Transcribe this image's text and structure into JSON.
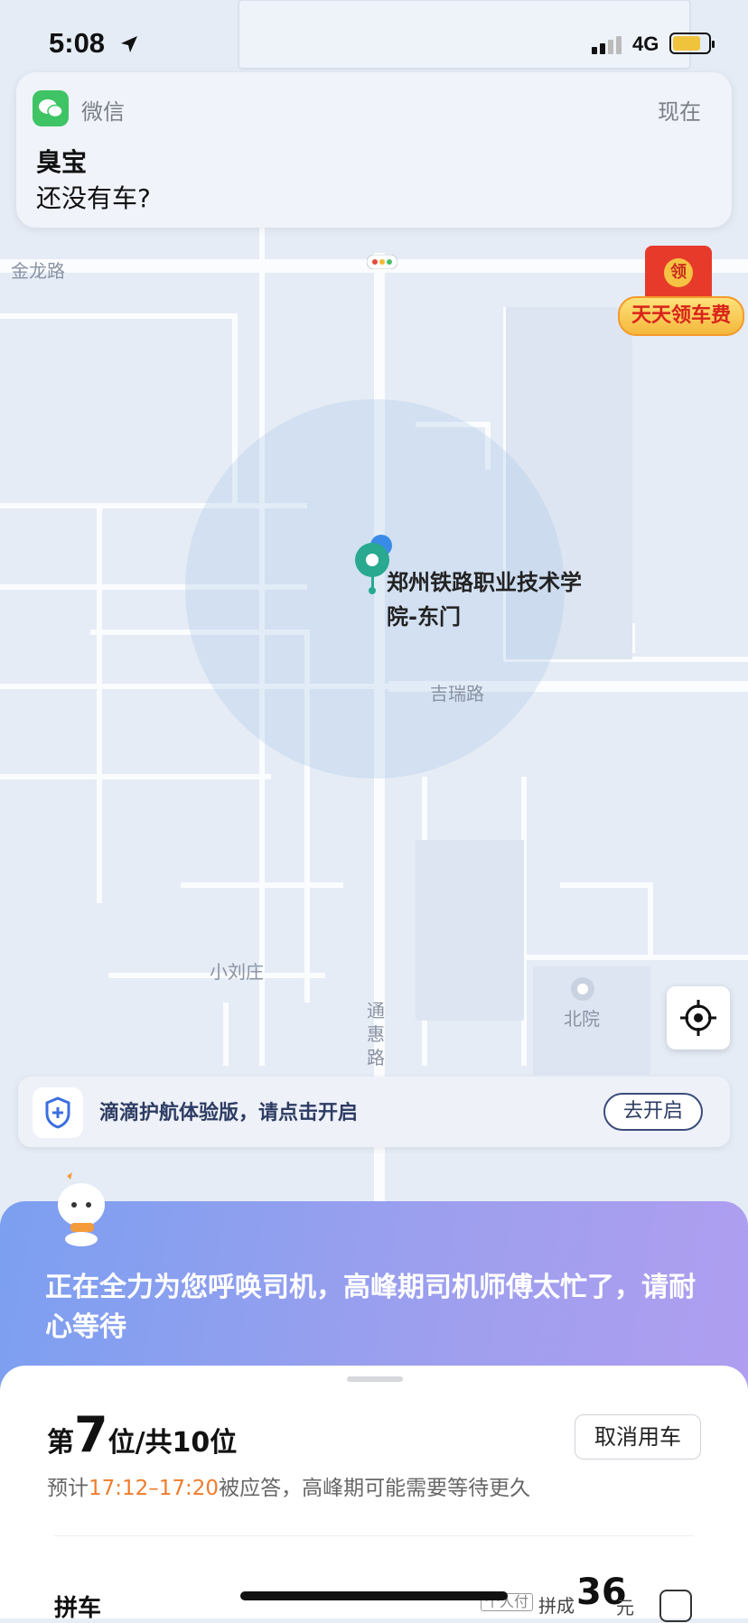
{
  "status_bar": {
    "time": "5:08",
    "network": "4G",
    "icons": [
      "location-arrow-icon",
      "signal-icon",
      "battery-icon"
    ]
  },
  "notification": {
    "app": "微信",
    "time": "现在",
    "title": "臭宝",
    "body": "还没有车?",
    "icon": "wechat-icon"
  },
  "map": {
    "road_labels": {
      "jinlong": "金龙路",
      "jirui": "吉瑞路",
      "xiaoliuzhuang": "小刘庄",
      "tonghui": "通惠路",
      "beiyuan": "北院"
    },
    "marker_label": "郑州铁路职业技术学院-东门"
  },
  "promo": {
    "coin": "领",
    "label": "天天领车费"
  },
  "safety": {
    "text": "滴滴护航体验版，请点击开启",
    "button": "去开启"
  },
  "calling": {
    "text": "正在全力为您呼唤司机，高峰期司机师傅太忙了，请耐心等待"
  },
  "queue": {
    "prefix": "第",
    "position": "7",
    "suffix": "位/共10位",
    "cancel": "取消用车"
  },
  "eta": {
    "prefix": "预计",
    "time_range": "17:12–17:20",
    "suffix": "被应答，高峰期可能需要等待更久"
  },
  "carpool": {
    "label": "拼车",
    "pay_tag": "个人付",
    "price_label": "拼成",
    "price": "36",
    "unit": "元"
  },
  "colors": {
    "accent_orange": "#ef7c2d",
    "wechat_green": "#3ec464",
    "gradient_start": "#7c9ff0",
    "gradient_end": "#b29ef0"
  }
}
